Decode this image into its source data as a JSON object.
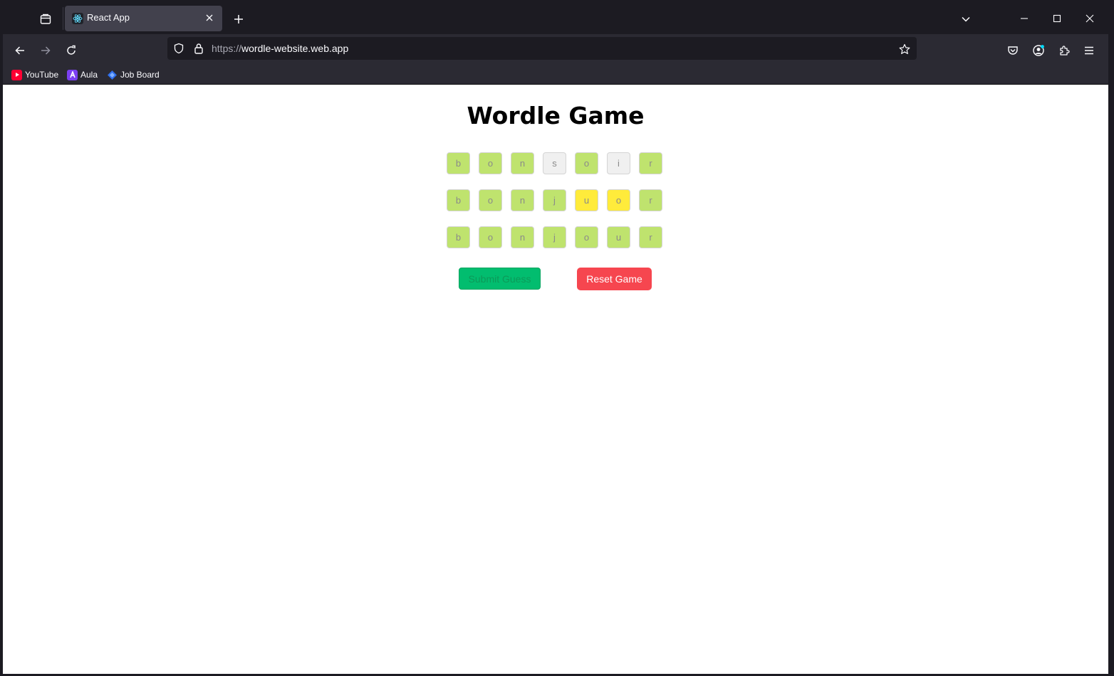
{
  "browser": {
    "tab": {
      "title": "React App"
    },
    "url": {
      "scheme": "https://",
      "host": "wordle-website.web.app"
    },
    "bookmarks": [
      {
        "label": "YouTube",
        "icon": "youtube-icon",
        "color": "#ff0033"
      },
      {
        "label": "Aula",
        "icon": "aula-icon",
        "color": "#7b3ff2"
      },
      {
        "label": "Job Board",
        "icon": "job-board-icon",
        "color": "#2f6fed"
      }
    ]
  },
  "game": {
    "title": "Wordle Game",
    "colors": {
      "correct": "#bfe36e",
      "present": "#ffeb3b",
      "absent": "#f0f0f0"
    },
    "rows": [
      [
        {
          "letter": "b",
          "state": "correct"
        },
        {
          "letter": "o",
          "state": "correct"
        },
        {
          "letter": "n",
          "state": "correct"
        },
        {
          "letter": "s",
          "state": "absent"
        },
        {
          "letter": "o",
          "state": "correct"
        },
        {
          "letter": "i",
          "state": "absent"
        },
        {
          "letter": "r",
          "state": "correct"
        }
      ],
      [
        {
          "letter": "b",
          "state": "correct"
        },
        {
          "letter": "o",
          "state": "correct"
        },
        {
          "letter": "n",
          "state": "correct"
        },
        {
          "letter": "j",
          "state": "correct"
        },
        {
          "letter": "u",
          "state": "present"
        },
        {
          "letter": "o",
          "state": "present"
        },
        {
          "letter": "r",
          "state": "correct"
        }
      ],
      [
        {
          "letter": "b",
          "state": "correct"
        },
        {
          "letter": "o",
          "state": "correct"
        },
        {
          "letter": "n",
          "state": "correct"
        },
        {
          "letter": "j",
          "state": "correct"
        },
        {
          "letter": "o",
          "state": "correct"
        },
        {
          "letter": "u",
          "state": "correct"
        },
        {
          "letter": "r",
          "state": "correct"
        }
      ]
    ],
    "submit_label": "Submit Guess",
    "reset_label": "Reset Game"
  }
}
